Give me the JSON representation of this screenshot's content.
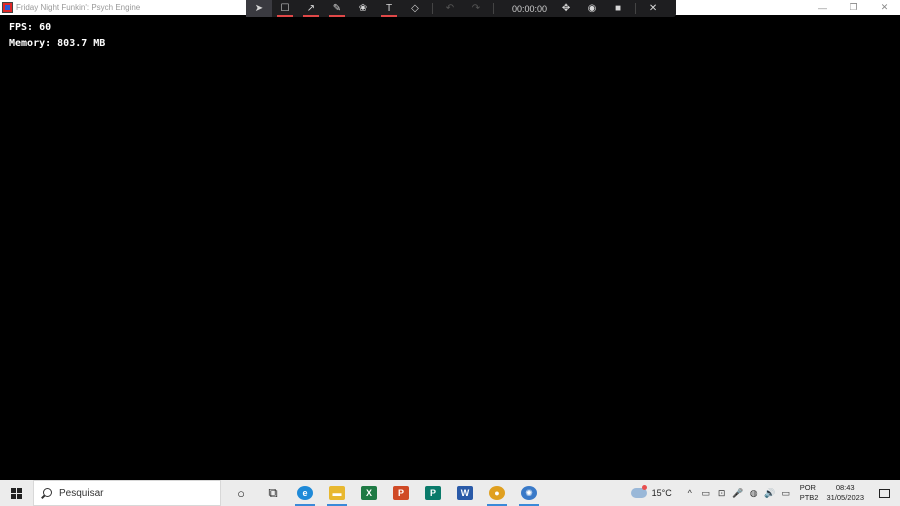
{
  "window": {
    "title": "Friday Night Funkin': Psych Engine",
    "controls": {
      "minimize": "—",
      "restore": "❐",
      "close": "✕"
    }
  },
  "recorder_toolbar": {
    "tools": [
      {
        "name": "select",
        "glyph": "➤"
      },
      {
        "name": "rectangle",
        "glyph": "☐"
      },
      {
        "name": "arrow",
        "glyph": "↗"
      },
      {
        "name": "pen",
        "glyph": "✎"
      },
      {
        "name": "highlighter",
        "glyph": "❀"
      },
      {
        "name": "text",
        "glyph": "T"
      },
      {
        "name": "eraser",
        "glyph": "◇"
      }
    ],
    "undo": "↶",
    "redo": "↷",
    "timer": "00:00:00",
    "move": "✥",
    "record": "◉",
    "stop": "■",
    "close": "✕"
  },
  "game": {
    "fps_line": "FPS: 60",
    "memory_line": "Memory: 803.7 MB"
  },
  "taskbar": {
    "search_placeholder": "Pesquisar",
    "apps": [
      {
        "name": "cortana",
        "glyph": "○",
        "color": "#222222"
      },
      {
        "name": "task-view",
        "glyph": "⧉",
        "color": "#222222"
      },
      {
        "name": "edge",
        "glyph": "e",
        "color": "#1f8ad8"
      },
      {
        "name": "file-explorer",
        "glyph": "▬",
        "color": "#e8b830"
      },
      {
        "name": "excel",
        "glyph": "X",
        "color": "#1e7a44"
      },
      {
        "name": "powerpoint",
        "glyph": "P",
        "color": "#d04a26"
      },
      {
        "name": "publisher",
        "glyph": "P",
        "color": "#0a7a6a"
      },
      {
        "name": "word",
        "glyph": "W",
        "color": "#2a5aa8"
      },
      {
        "name": "chrome",
        "glyph": "●",
        "color": "#e0a020"
      },
      {
        "name": "game-app",
        "glyph": "✺",
        "color": "#3a7ac8"
      }
    ],
    "weather": {
      "temperature": "15°C"
    },
    "tray_icons": [
      "^",
      "▭",
      "⊡",
      "🎤",
      "◍",
      "🔊",
      "▭"
    ],
    "language": {
      "line1": "POR",
      "line2": "PTB2"
    },
    "clock": {
      "time": "08:43",
      "date": "31/05/2023"
    }
  }
}
